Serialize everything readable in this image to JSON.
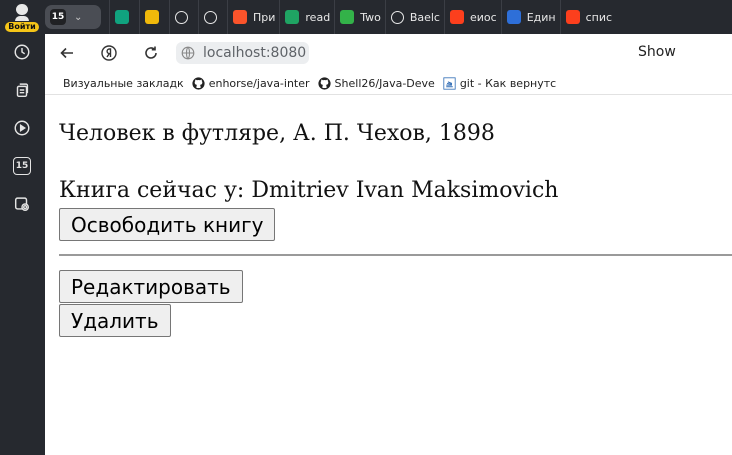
{
  "sidebar": {
    "login_label": "Войти",
    "badge_text": "15",
    "icons": [
      "history-icon",
      "collections-icon",
      "media-icon",
      "calendar-icon",
      "screenshot-icon"
    ]
  },
  "tabbar": {
    "pinned_badge": "15",
    "tabs": [
      {
        "label": "",
        "icon": "chatgpt-icon",
        "color": "#10a37f"
      },
      {
        "label": "",
        "icon": "ethereum-icon",
        "color": "#f0b90b"
      },
      {
        "label": "",
        "icon": "link-icon",
        "color": "#e8e8e8"
      },
      {
        "label": "",
        "icon": "github-icon",
        "color": "#e8e8e8"
      },
      {
        "label": "При",
        "icon": "brave-icon",
        "color": "#fb542b"
      },
      {
        "label": "read",
        "icon": "sheet-icon",
        "color": "#1fa463"
      },
      {
        "label": "Two",
        "icon": "feather-icon",
        "color": "#33b249"
      },
      {
        "label": "Baelc",
        "icon": "github-icon",
        "color": "#e8e8e8"
      },
      {
        "label": "еиос",
        "icon": "yandex-icon",
        "color": "#fc3f1d"
      },
      {
        "label": "Един",
        "icon": "drop-icon",
        "color": "#2e6fd8"
      },
      {
        "label": "спис",
        "icon": "yandex-icon",
        "color": "#fc3f1d"
      }
    ]
  },
  "navbar": {
    "url": "localhost:8080",
    "show_label": "Show"
  },
  "bookmarks": [
    {
      "label": "Визуальные закладк",
      "icon": ""
    },
    {
      "label": "enhorse/java-inter",
      "icon": "github-icon"
    },
    {
      "label": "Shell26/Java-Deve",
      "icon": "github-icon"
    },
    {
      "label": "git - Как вернутс",
      "icon": "stackoverflow-icon"
    }
  ],
  "page": {
    "book_title": "Человек в футляре, А. П. Чехов, 1898",
    "owner_text": "Книга сейчас у: Dmitriev Ivan Maksimovich",
    "release_button": "Освободить книгу",
    "edit_button": "Редактировать",
    "delete_button": "Удалить"
  }
}
